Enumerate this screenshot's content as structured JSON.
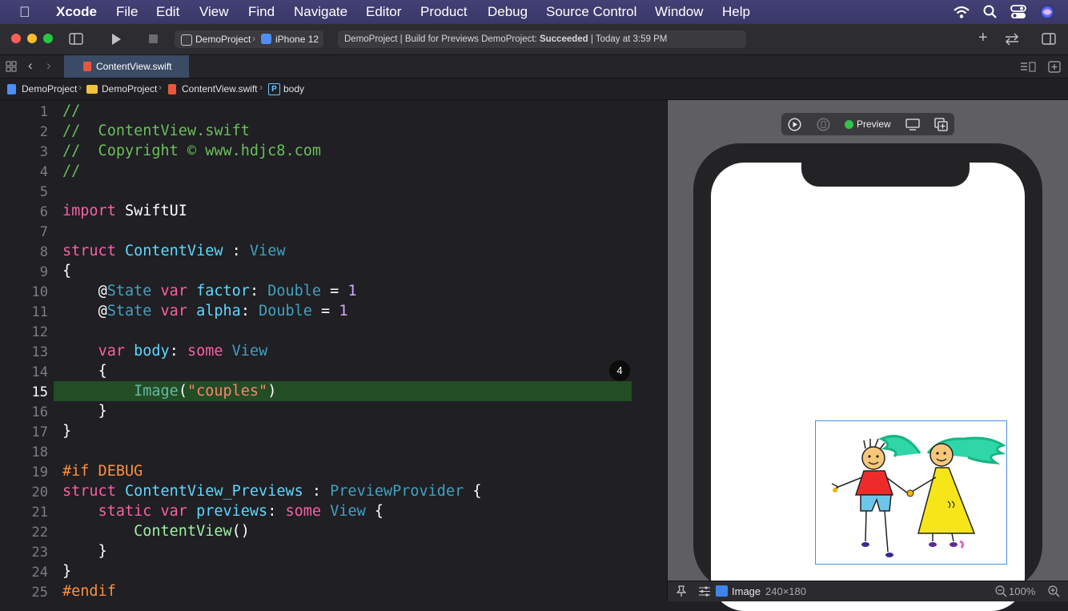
{
  "menubar": {
    "app": "Xcode",
    "items": [
      "File",
      "Edit",
      "View",
      "Find",
      "Navigate",
      "Editor",
      "Product",
      "Debug",
      "Source Control",
      "Window",
      "Help"
    ]
  },
  "toolbar": {
    "project": "DemoProject",
    "device": "iPhone 12",
    "status_prefix": "DemoProject | Build for Previews DemoProject:",
    "status_result": "Succeeded",
    "status_time": "| Today at 3:59 PM"
  },
  "tab": {
    "title": "ContentView.swift"
  },
  "jumpbar": {
    "crumbs": [
      "DemoProject",
      "DemoProject",
      "ContentView.swift",
      "body"
    ]
  },
  "editor": {
    "line_numbers": [
      "1",
      "2",
      "3",
      "4",
      "5",
      "6",
      "7",
      "8",
      "9",
      "10",
      "11",
      "12",
      "13",
      "14",
      "15",
      "16",
      "17",
      "18",
      "19",
      "20",
      "21",
      "22",
      "23",
      "24",
      "25"
    ],
    "current_line": "15",
    "issue_count": "4",
    "tokens": {
      "l1": "//",
      "l2": "//  ContentView.swift",
      "l3": "//  Copyright © www.hdjc8.com",
      "l4": "//",
      "import": "import",
      "swiftui": "SwiftUI",
      "struct": "struct",
      "contentview": "ContentView",
      "colon": " : ",
      "view": "View",
      "lbrace": "{",
      "at": "@",
      "state": "State",
      "var": "var",
      "factor": "factor",
      "alpha": "alpha",
      "colon2": ": ",
      "double": "Double",
      "eq": " = ",
      "one": "1",
      "body": "body",
      "some": "some",
      "image": "Image",
      "lparen": "(",
      "couples": "\"couples\"",
      "rparen": ")",
      "rbrace": "}",
      "ifdebug": "#if DEBUG",
      "previews_struct": "ContentView_Previews",
      "previewprovider": "PreviewProvider",
      "static": "static",
      "previews": "previews",
      "call": "()",
      "endif": "#endif"
    }
  },
  "canvas": {
    "preview_label": "Preview",
    "selection_label": "Image",
    "selection_size": "240×180",
    "zoom": "100%"
  }
}
